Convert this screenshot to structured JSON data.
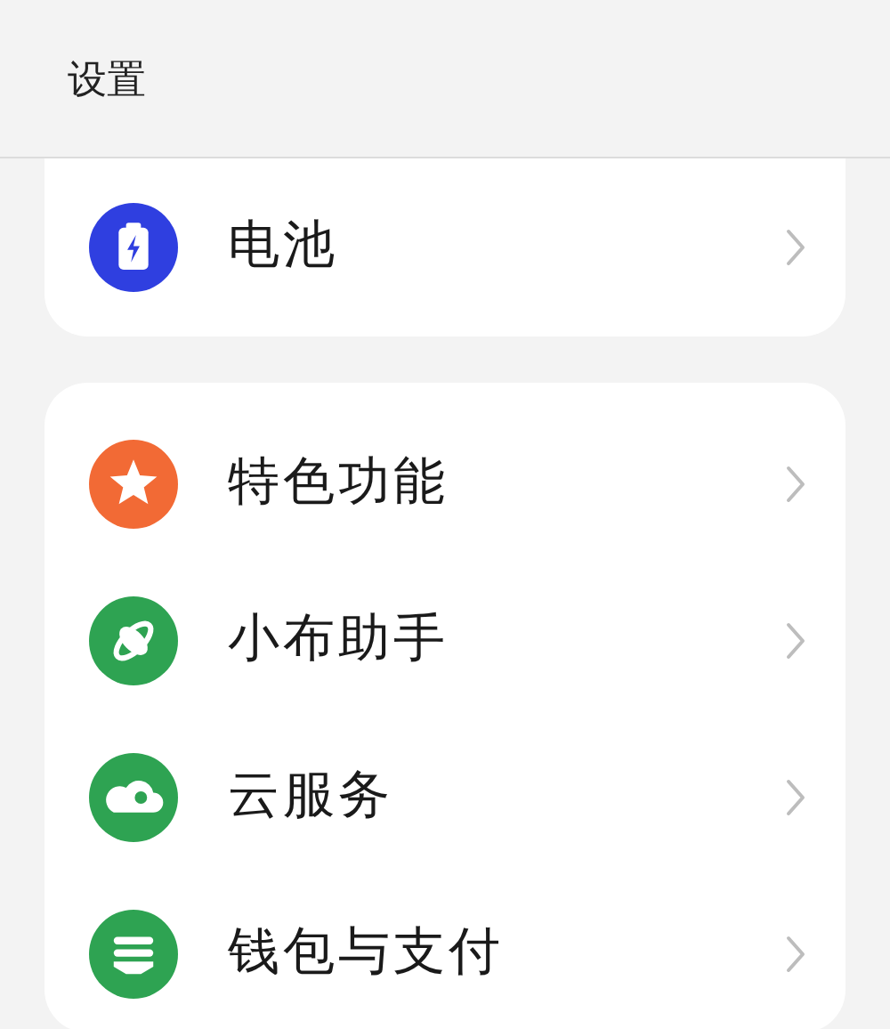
{
  "header": {
    "title": "设置"
  },
  "groups": [
    {
      "items": [
        {
          "label": "电池",
          "kind": "battery",
          "color": "#2f3fe0"
        }
      ]
    },
    {
      "items": [
        {
          "label": "特色功能",
          "kind": "star",
          "color": "#f26a35"
        },
        {
          "label": "小布助手",
          "kind": "assistant",
          "color": "#2ea352"
        },
        {
          "label": "云服务",
          "kind": "cloud",
          "color": "#2ea352"
        },
        {
          "label": "钱包与支付",
          "kind": "wallet",
          "color": "#2ea352"
        }
      ]
    }
  ]
}
